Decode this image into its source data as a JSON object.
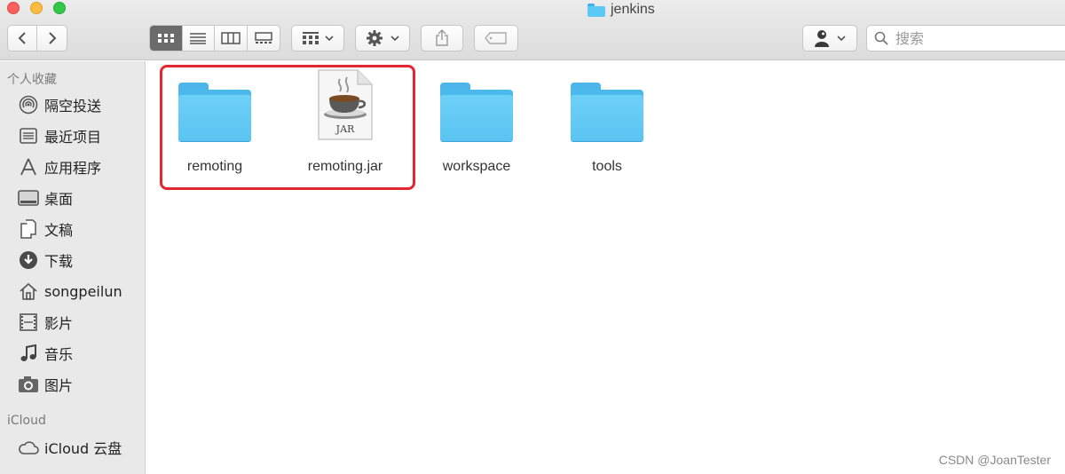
{
  "window": {
    "title": "jenkins"
  },
  "toolbar": {
    "back_icon": "chevron-left-icon",
    "forward_icon": "chevron-right-icon",
    "view_modes": [
      "icon-view-icon",
      "list-view-icon",
      "column-view-icon",
      "gallery-view-icon"
    ],
    "active_view": "icon-view-icon",
    "arrange_icon": "arrange-grid-icon",
    "action_icon": "gear-icon",
    "share_icon": "share-icon",
    "tag_icon": "tag-icon",
    "user_icon": "user-icon"
  },
  "search": {
    "placeholder": "搜索"
  },
  "sidebar": {
    "favorites_header": "个人收藏",
    "favorites": [
      {
        "label": "隔空投送",
        "icon": "airdrop-icon"
      },
      {
        "label": "最近项目",
        "icon": "recents-icon"
      },
      {
        "label": "应用程序",
        "icon": "applications-icon"
      },
      {
        "label": "桌面",
        "icon": "desktop-icon"
      },
      {
        "label": "文稿",
        "icon": "documents-icon"
      },
      {
        "label": "下载",
        "icon": "downloads-icon"
      },
      {
        "label": "songpeilun",
        "icon": "home-icon"
      },
      {
        "label": "影片",
        "icon": "movies-icon"
      },
      {
        "label": "音乐",
        "icon": "music-icon"
      },
      {
        "label": "图片",
        "icon": "pictures-icon"
      }
    ],
    "icloud_header": "iCloud",
    "icloud": [
      {
        "label": "iCloud 云盘",
        "icon": "icloud-icon"
      }
    ]
  },
  "files": [
    {
      "name": "remoting",
      "kind": "folder"
    },
    {
      "name": "remoting.jar",
      "kind": "jar",
      "badge": "JAR"
    },
    {
      "name": "workspace",
      "kind": "folder"
    },
    {
      "name": "tools",
      "kind": "folder"
    }
  ],
  "colors": {
    "highlight": "#e3262f",
    "folder": "#5ac4f2"
  },
  "watermark": "CSDN @JoanTester"
}
